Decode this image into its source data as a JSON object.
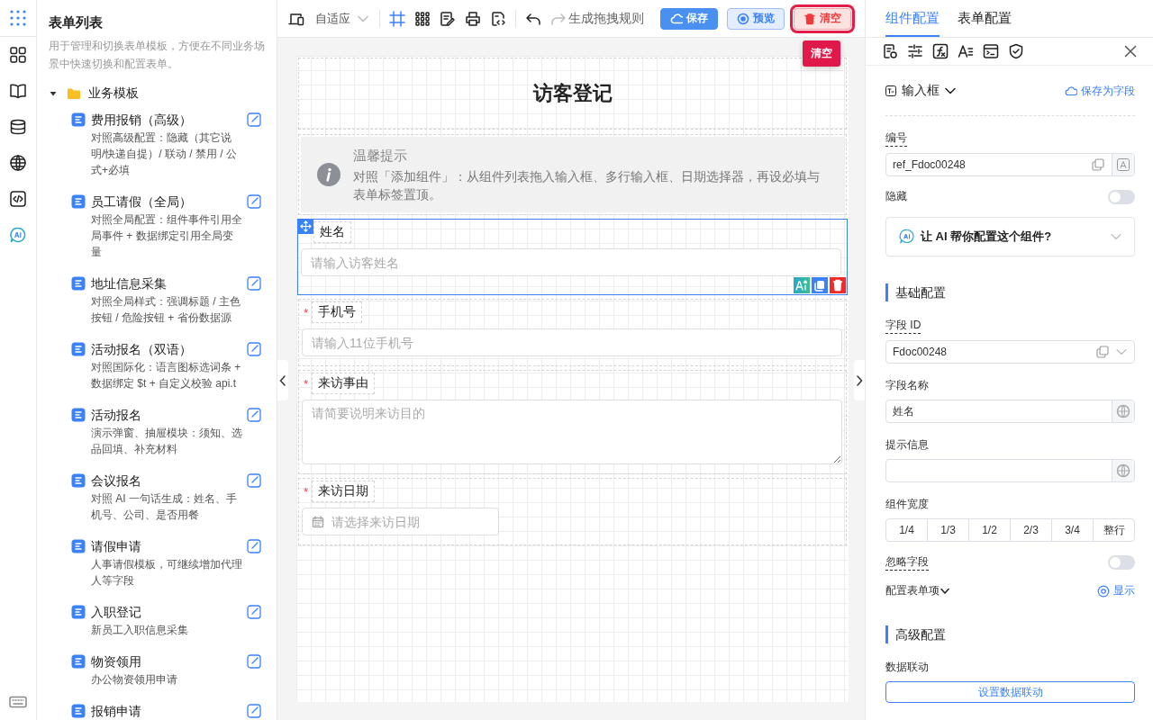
{
  "form_list": {
    "title": "表单列表",
    "description": "用于管理和切换表单模板，方便在不同业务场景中快速切换和配置表单。",
    "folder": {
      "label": "业务模板",
      "expanded": true,
      "items": [
        {
          "title": "费用报销（高级）",
          "desc": "对照高级配置：隐藏（其它说明/快递自提）/ 联动 / 禁用 / 公式+必填"
        },
        {
          "title": "员工请假（全局）",
          "desc": "对照全局配置：组件事件引用全局事件 + 数据绑定引用全局变量"
        },
        {
          "title": "地址信息采集",
          "desc": "对照全局样式：强调标题 / 主色按钮 / 危险按钮 + 省份数据源"
        },
        {
          "title": "活动报名（双语）",
          "desc": "对照国际化：语言图标选词条 + 数据绑定 $t + 自定义校验 api.t"
        },
        {
          "title": "活动报名",
          "desc": "演示弹窗、抽屉模块：须知、选品回填、补充材料"
        },
        {
          "title": "会议报名",
          "desc": "对照 AI 一句话生成：姓名、手机号、公司、是否用餐"
        },
        {
          "title": "请假申请",
          "desc": "人事请假模板，可继续增加代理人等字段"
        },
        {
          "title": "入职登记",
          "desc": "新员工入职信息采集"
        },
        {
          "title": "物资领用",
          "desc": "办公物资领用申请"
        },
        {
          "title": "报销申请"
        }
      ]
    }
  },
  "toolbar": {
    "device_label": "自适应",
    "tools": [
      {
        "kind": "frame",
        "selected": true
      },
      {
        "kind": "grid",
        "selected": false
      },
      {
        "kind": "edit",
        "selected": false
      },
      {
        "kind": "print",
        "selected": false
      },
      {
        "kind": "code",
        "selected": false
      }
    ],
    "undo_disabled": false,
    "redo_disabled": true,
    "rule_label": "生成拖拽规则",
    "buttons": [
      {
        "label": "保存",
        "kind": "primary",
        "focused": false
      },
      {
        "label": "预览",
        "kind": "secondary",
        "focused": false
      },
      {
        "label": "清空",
        "kind": "danger",
        "focused": true
      }
    ],
    "tooltip": "清空"
  },
  "canvas": {
    "title": "访客登记",
    "notice": {
      "title": "温馨提示",
      "text": "对照「添加组件」：从组件列表拖入输入框、多行输入框、日期选择器，再设必填与表单标签置顶。"
    },
    "fields": [
      {
        "label": "姓名",
        "required": false,
        "kind": "input",
        "placeholder": "请输入访客姓名",
        "selected": true
      },
      {
        "label": "手机号",
        "required": true,
        "required_mark": "*",
        "kind": "input",
        "placeholder": "请输入11位手机号",
        "selected": false
      },
      {
        "label": "来访事由",
        "required": true,
        "required_mark": "*",
        "kind": "textarea",
        "placeholder": "请简要说明来访目的",
        "selected": false
      },
      {
        "label": "来访日期",
        "required": true,
        "required_mark": "*",
        "kind": "date",
        "placeholder": "请选择来访日期",
        "selected": false
      }
    ]
  },
  "config": {
    "tabs": [
      {
        "label": "组件配置",
        "selected": true
      },
      {
        "label": "表单配置",
        "selected": false
      }
    ],
    "type_label": "输入框",
    "save_link": "保存为字段",
    "top_rows": [
      {
        "kind": "ref-input",
        "label": "编号",
        "tip": true,
        "value": "ref_Fdoc00248"
      },
      {
        "kind": "toggle",
        "label": "隐藏",
        "tip": false,
        "on": false
      },
      {
        "kind": "ai-card",
        "text": "让 AI 帮你配置这个组件?",
        "expanded": false
      }
    ],
    "sections": [
      {
        "title": "基础配置",
        "rows": [
          {
            "kind": "id-select",
            "label": "字段 ID",
            "tip": true,
            "value": "Fdoc00248"
          },
          {
            "kind": "input-i18n",
            "label": "字段名称",
            "tip": false,
            "value": "姓名"
          },
          {
            "kind": "input-i18n",
            "label": "提示信息",
            "tip": false
          },
          {
            "kind": "segmented",
            "label": "组件宽度",
            "tip": false,
            "options": [
              {
                "label": "1/4",
                "selected": false
              },
              {
                "label": "1/3",
                "selected": false
              },
              {
                "label": "1/2",
                "selected": false
              },
              {
                "label": "2/3",
                "selected": false
              },
              {
                "label": "3/4",
                "selected": false
              },
              {
                "label": "整行",
                "selected": false
              }
            ]
          },
          {
            "kind": "toggle",
            "label": "忽略字段",
            "tip": true,
            "on": false
          },
          {
            "kind": "collapse-link",
            "label": "配置表单项",
            "link": "显示",
            "expanded": false
          }
        ]
      },
      {
        "title": "高级配置",
        "rows": [
          {
            "kind": "button",
            "label": "数据联动",
            "tip": false,
            "button": "设置数据联动"
          }
        ]
      }
    ]
  }
}
